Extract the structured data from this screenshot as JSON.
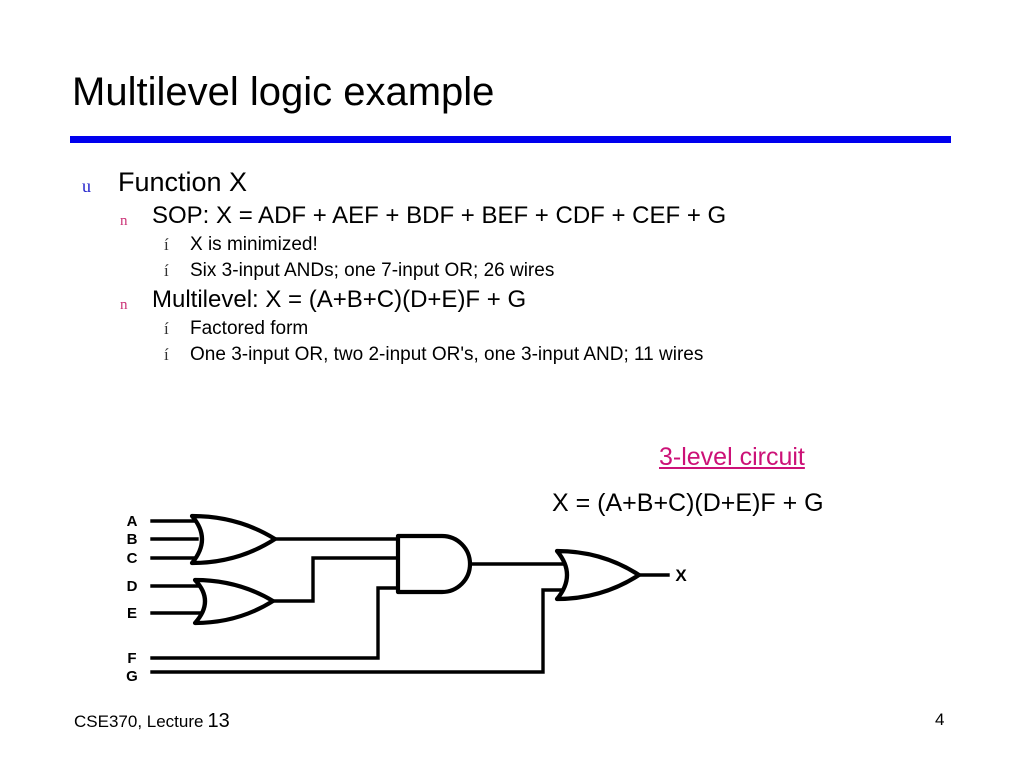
{
  "slide": {
    "title": "Multilevel logic example",
    "rule_color": "#0000EE"
  },
  "bullets": {
    "markers": {
      "level1": "u",
      "level2": "n",
      "level3": "í"
    },
    "items": [
      {
        "level": 1,
        "text": "Function X"
      },
      {
        "level": 2,
        "text": "SOP:  X = ADF + AEF + BDF + BEF + CDF + CEF + G"
      },
      {
        "level": 3,
        "text": "X is minimized!"
      },
      {
        "level": 3,
        "text": "Six 3-input ANDs; one 7-input OR; 26 wires"
      },
      {
        "level": 2,
        "text": "Multilevel:  X = (A+B+C)(D+E)F + G"
      },
      {
        "level": 3,
        "text": "Factored form"
      },
      {
        "level": 3,
        "text": "One 3-input OR, two 2-input OR's, one 3-input AND; 11 wires"
      }
    ]
  },
  "circuit": {
    "caption": "3-level circuit",
    "caption_color": "#CC1177",
    "equation": "X = (A+B+C)(D+E)F + G",
    "input_labels": [
      "A",
      "B",
      "C",
      "D",
      "E",
      "F",
      "G"
    ],
    "output_label": "X",
    "gates": [
      {
        "name": "or-gate-abc",
        "type": "OR",
        "inputs": [
          "A",
          "B",
          "C"
        ]
      },
      {
        "name": "or-gate-de",
        "type": "OR",
        "inputs": [
          "D",
          "E"
        ]
      },
      {
        "name": "and-gate",
        "type": "AND",
        "inputs": [
          "A+B+C",
          "D+E",
          "F"
        ]
      },
      {
        "name": "or-gate-output",
        "type": "OR",
        "inputs": [
          "(A+B+C)(D+E)F",
          "G"
        ]
      }
    ]
  },
  "footer": {
    "course": "CSE370, Lecture",
    "lecture_number": "13",
    "page_number": "4"
  }
}
